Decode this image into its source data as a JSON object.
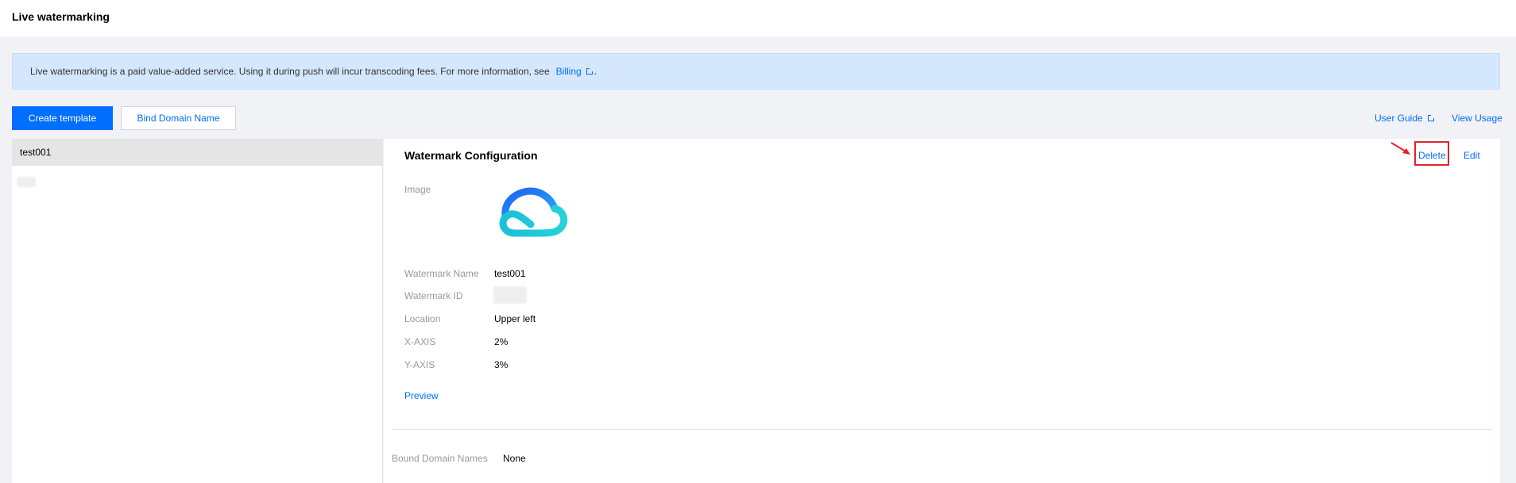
{
  "header": {
    "title": "Live watermarking"
  },
  "notice": {
    "text": "Live watermarking is a paid value-added service. Using it during push will incur transcoding fees. For more information, see",
    "link": "Billing",
    "suffix": "."
  },
  "toolbar": {
    "create_label": "Create template",
    "bind_label": "Bind Domain Name",
    "user_guide": "User Guide",
    "view_usage": "View Usage"
  },
  "sidebar": {
    "items": [
      {
        "label": "test001",
        "active": true
      }
    ]
  },
  "detail": {
    "title": "Watermark Configuration",
    "delete_label": "Delete",
    "edit_label": "Edit",
    "image_label": "Image",
    "fields": [
      {
        "label": "Watermark Name",
        "value": "test001"
      },
      {
        "label": "Watermark ID",
        "value": ""
      },
      {
        "label": "Location",
        "value": "Upper left"
      },
      {
        "label": "X-AXIS",
        "value": "2%"
      },
      {
        "label": "Y-AXIS",
        "value": "3%"
      }
    ],
    "preview_label": "Preview",
    "bound_domains_label": "Bound Domain Names",
    "bound_domains_value": "None"
  },
  "colors": {
    "accent": "#006eff",
    "notice_bg": "#d5e7fd",
    "highlight": "#e0242a",
    "logo_blue": "#1e7bf5",
    "logo_cyan": "#1ec3d9"
  }
}
